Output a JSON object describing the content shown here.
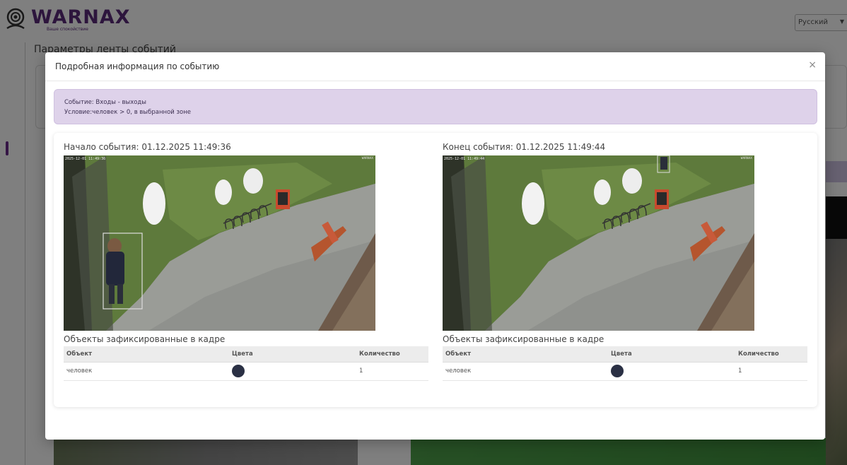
{
  "brand": {
    "title": "WARNAX",
    "subtitle": "Ваше спокойствие"
  },
  "language": {
    "selected": "Русский"
  },
  "background": {
    "page_title": "Параметры ленты событий"
  },
  "modal": {
    "title": "Подробная информация по событию",
    "close_glyph": "×"
  },
  "alert": {
    "event_line": "Событие: Входы - выходы",
    "condition_line": "Условие:человек > 0, в выбранной зоне"
  },
  "start": {
    "title": "Начало события: 01.12.2025 11:49:36",
    "cam_timestamp": "2025-12-01 11:49:36",
    "cam_id": "WARNAX",
    "objects_title": "Объекты зафиксированные в кадре",
    "table": {
      "headers": [
        "Объект",
        "Цвета",
        "Количество"
      ],
      "rows": [
        {
          "object": "человек",
          "color": "#2a3044",
          "count": "1"
        }
      ]
    }
  },
  "end": {
    "title": "Конец события: 01.12.2025 11:49:44",
    "cam_timestamp": "2025-12-01 11:49:44",
    "cam_id": "WARNAX",
    "objects_title": "Объекты зафиксированные в кадре",
    "table": {
      "headers": [
        "Объект",
        "Цвета",
        "Количество"
      ],
      "rows": [
        {
          "object": "человек",
          "color": "#2a3044",
          "count": "1"
        }
      ]
    }
  },
  "colors": {
    "brand": "#5a2a7a",
    "alert_bg": "#ded2ea",
    "detection_box": "#dddddd"
  }
}
